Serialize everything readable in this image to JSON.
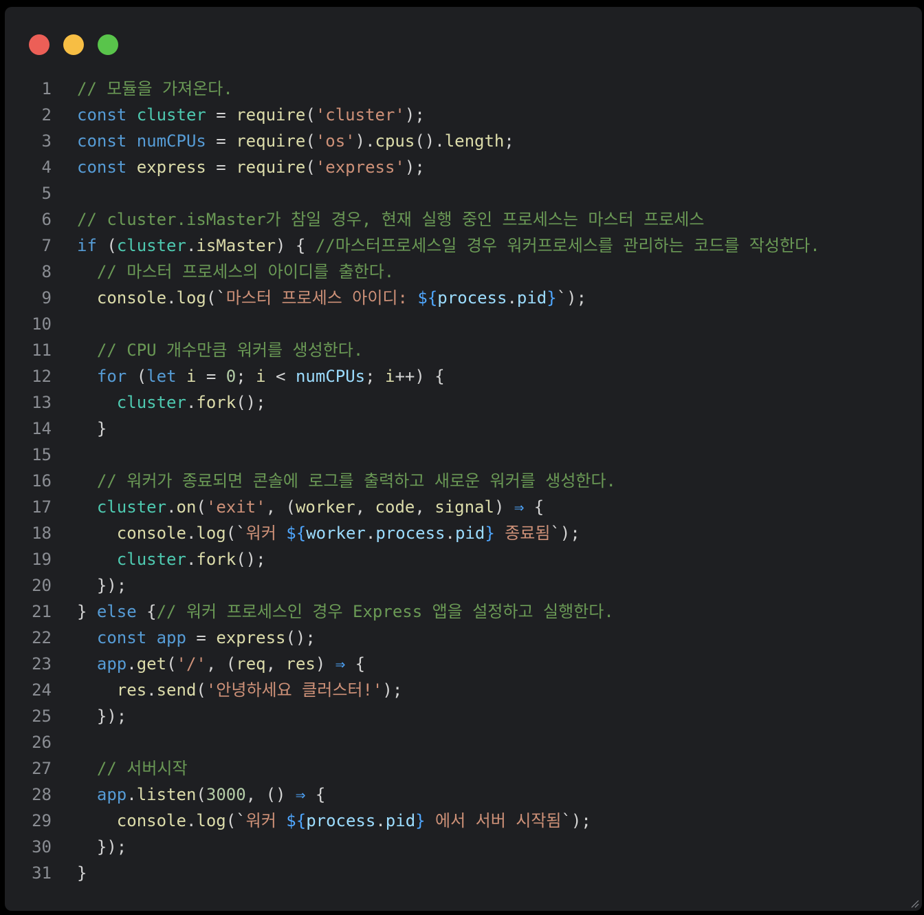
{
  "colors": {
    "background": "#1e1f22",
    "close": "#ec5f57",
    "minimize": "#f7be44",
    "zoom": "#59c44b",
    "line_number": "#8a8d93",
    "comment": "#6a9955",
    "keyword": "#569cd6",
    "identifier": "#4ec9b0",
    "function": "#dcdcaa",
    "string": "#ce9178",
    "number": "#b5cea8",
    "variable": "#9cdcfe",
    "punct": "#d4d4d4",
    "operator": "#4fa7ff"
  },
  "window_controls": [
    "close",
    "minimize",
    "zoom"
  ],
  "code_lines": [
    [
      [
        "comment",
        "// 모듈을 가져온다."
      ]
    ],
    [
      [
        "keyword",
        "const"
      ],
      [
        "punct",
        " "
      ],
      [
        "identifier",
        "cluster"
      ],
      [
        "punct",
        " = "
      ],
      [
        "function",
        "require"
      ],
      [
        "punct",
        "("
      ],
      [
        "string",
        "'cluster'"
      ],
      [
        "punct",
        ");"
      ]
    ],
    [
      [
        "keyword",
        "const"
      ],
      [
        "punct",
        " "
      ],
      [
        "keyword",
        "numCPUs"
      ],
      [
        "punct",
        " = "
      ],
      [
        "function",
        "require"
      ],
      [
        "punct",
        "("
      ],
      [
        "string",
        "'os'"
      ],
      [
        "punct",
        ")."
      ],
      [
        "function",
        "cpus"
      ],
      [
        "punct",
        "()."
      ],
      [
        "function",
        "length"
      ],
      [
        "punct",
        ";"
      ]
    ],
    [
      [
        "keyword",
        "const"
      ],
      [
        "punct",
        " "
      ],
      [
        "function",
        "express"
      ],
      [
        "punct",
        " = "
      ],
      [
        "function",
        "require"
      ],
      [
        "punct",
        "("
      ],
      [
        "string",
        "'express'"
      ],
      [
        "punct",
        ");"
      ]
    ],
    [],
    [
      [
        "comment",
        "// cluster.isMaster가 참일 경우, 현재 실행 중인 프로세스는 마스터 프로세스"
      ]
    ],
    [
      [
        "keyword",
        "if"
      ],
      [
        "punct",
        " ("
      ],
      [
        "identifier",
        "cluster"
      ],
      [
        "punct",
        "."
      ],
      [
        "function",
        "isMaster"
      ],
      [
        "punct",
        ") { "
      ],
      [
        "comment",
        "//마스터프로세스일 경우 워커프로세스를 관리하는 코드를 작성한다."
      ]
    ],
    [
      [
        "punct",
        "  "
      ],
      [
        "comment",
        "// 마스터 프로세스의 아이디를 출한다."
      ]
    ],
    [
      [
        "punct",
        "  "
      ],
      [
        "function",
        "console"
      ],
      [
        "punct",
        "."
      ],
      [
        "function",
        "log"
      ],
      [
        "punct",
        "(`"
      ],
      [
        "string",
        "마스터 프로세스 아이디: "
      ],
      [
        "operator",
        "${"
      ],
      [
        "variable",
        "process"
      ],
      [
        "punct",
        "."
      ],
      [
        "variable",
        "pid"
      ],
      [
        "operator",
        "}"
      ],
      [
        "punct",
        "`);"
      ]
    ],
    [],
    [
      [
        "punct",
        "  "
      ],
      [
        "comment",
        "// CPU 개수만큼 워커를 생성한다."
      ]
    ],
    [
      [
        "punct",
        "  "
      ],
      [
        "keyword",
        "for"
      ],
      [
        "punct",
        " ("
      ],
      [
        "keyword",
        "let"
      ],
      [
        "punct",
        " "
      ],
      [
        "function",
        "i"
      ],
      [
        "punct",
        " = "
      ],
      [
        "number",
        "0"
      ],
      [
        "punct",
        "; "
      ],
      [
        "function",
        "i"
      ],
      [
        "punct",
        " < "
      ],
      [
        "variable",
        "numCPUs"
      ],
      [
        "punct",
        "; "
      ],
      [
        "function",
        "i"
      ],
      [
        "punct",
        "++) {"
      ]
    ],
    [
      [
        "punct",
        "    "
      ],
      [
        "identifier",
        "cluster"
      ],
      [
        "punct",
        "."
      ],
      [
        "function",
        "fork"
      ],
      [
        "punct",
        "();"
      ]
    ],
    [
      [
        "punct",
        "  }"
      ]
    ],
    [],
    [
      [
        "punct",
        "  "
      ],
      [
        "comment",
        "// 워커가 종료되면 콘솔에 로그를 출력하고 새로운 워커를 생성한다."
      ]
    ],
    [
      [
        "punct",
        "  "
      ],
      [
        "identifier",
        "cluster"
      ],
      [
        "punct",
        "."
      ],
      [
        "function",
        "on"
      ],
      [
        "punct",
        "("
      ],
      [
        "string",
        "'exit'"
      ],
      [
        "punct",
        ", ("
      ],
      [
        "function",
        "worker"
      ],
      [
        "punct",
        ", "
      ],
      [
        "function",
        "code"
      ],
      [
        "punct",
        ", "
      ],
      [
        "function",
        "signal"
      ],
      [
        "punct",
        ") "
      ],
      [
        "operator",
        "⇒"
      ],
      [
        "punct",
        " {"
      ]
    ],
    [
      [
        "punct",
        "    "
      ],
      [
        "function",
        "console"
      ],
      [
        "punct",
        "."
      ],
      [
        "function",
        "log"
      ],
      [
        "punct",
        "(`"
      ],
      [
        "string",
        "워커 "
      ],
      [
        "operator",
        "${"
      ],
      [
        "variable",
        "worker"
      ],
      [
        "punct",
        "."
      ],
      [
        "variable",
        "process"
      ],
      [
        "punct",
        "."
      ],
      [
        "variable",
        "pid"
      ],
      [
        "operator",
        "}"
      ],
      [
        "string",
        " 종료됨"
      ],
      [
        "punct",
        "`);"
      ]
    ],
    [
      [
        "punct",
        "    "
      ],
      [
        "identifier",
        "cluster"
      ],
      [
        "punct",
        "."
      ],
      [
        "function",
        "fork"
      ],
      [
        "punct",
        "();"
      ]
    ],
    [
      [
        "punct",
        "  });"
      ]
    ],
    [
      [
        "punct",
        "} "
      ],
      [
        "keyword",
        "else"
      ],
      [
        "punct",
        " {"
      ],
      [
        "comment",
        "// 워커 프로세스인 경우 Express 앱을 설정하고 실행한다."
      ]
    ],
    [
      [
        "punct",
        "  "
      ],
      [
        "keyword",
        "const"
      ],
      [
        "punct",
        " "
      ],
      [
        "keyword",
        "app"
      ],
      [
        "punct",
        " = "
      ],
      [
        "function",
        "express"
      ],
      [
        "punct",
        "();"
      ]
    ],
    [
      [
        "punct",
        "  "
      ],
      [
        "keyword",
        "app"
      ],
      [
        "punct",
        "."
      ],
      [
        "function",
        "get"
      ],
      [
        "punct",
        "("
      ],
      [
        "string",
        "'/'"
      ],
      [
        "punct",
        ", ("
      ],
      [
        "function",
        "req"
      ],
      [
        "punct",
        ", "
      ],
      [
        "function",
        "res"
      ],
      [
        "punct",
        ") "
      ],
      [
        "operator",
        "⇒"
      ],
      [
        "punct",
        " {"
      ]
    ],
    [
      [
        "punct",
        "    "
      ],
      [
        "function",
        "res"
      ],
      [
        "punct",
        "."
      ],
      [
        "function",
        "send"
      ],
      [
        "punct",
        "("
      ],
      [
        "string",
        "'안녕하세요 클러스터!'"
      ],
      [
        "punct",
        ");"
      ]
    ],
    [
      [
        "punct",
        "  });"
      ]
    ],
    [],
    [
      [
        "punct",
        "  "
      ],
      [
        "comment",
        "// 서버시작"
      ]
    ],
    [
      [
        "punct",
        "  "
      ],
      [
        "keyword",
        "app"
      ],
      [
        "punct",
        "."
      ],
      [
        "function",
        "listen"
      ],
      [
        "punct",
        "("
      ],
      [
        "number",
        "3000"
      ],
      [
        "punct",
        ", () "
      ],
      [
        "operator",
        "⇒"
      ],
      [
        "punct",
        " {"
      ]
    ],
    [
      [
        "punct",
        "    "
      ],
      [
        "function",
        "console"
      ],
      [
        "punct",
        "."
      ],
      [
        "function",
        "log"
      ],
      [
        "punct",
        "(`"
      ],
      [
        "string",
        "워커 "
      ],
      [
        "operator",
        "${"
      ],
      [
        "variable",
        "process"
      ],
      [
        "punct",
        "."
      ],
      [
        "variable",
        "pid"
      ],
      [
        "operator",
        "}"
      ],
      [
        "string",
        " 에서 서버 시작됨"
      ],
      [
        "punct",
        "`);"
      ]
    ],
    [
      [
        "punct",
        "  });"
      ]
    ],
    [
      [
        "punct",
        "}"
      ]
    ]
  ]
}
